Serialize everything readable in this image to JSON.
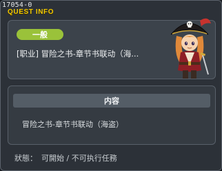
{
  "window": {
    "id_tag": "17054-0",
    "title": "QUEST INFO"
  },
  "quest": {
    "category": "一般",
    "name": "[职业] 冒险之书-章节书联动（海..."
  },
  "npc": {
    "icon": "pirate-captain-npc-icon"
  },
  "content": {
    "header": "内容",
    "text": "冒险之书-章节书联动（海盗）"
  },
  "status": {
    "label": "狀態：",
    "value": "可開始 / 不可执行任務"
  }
}
